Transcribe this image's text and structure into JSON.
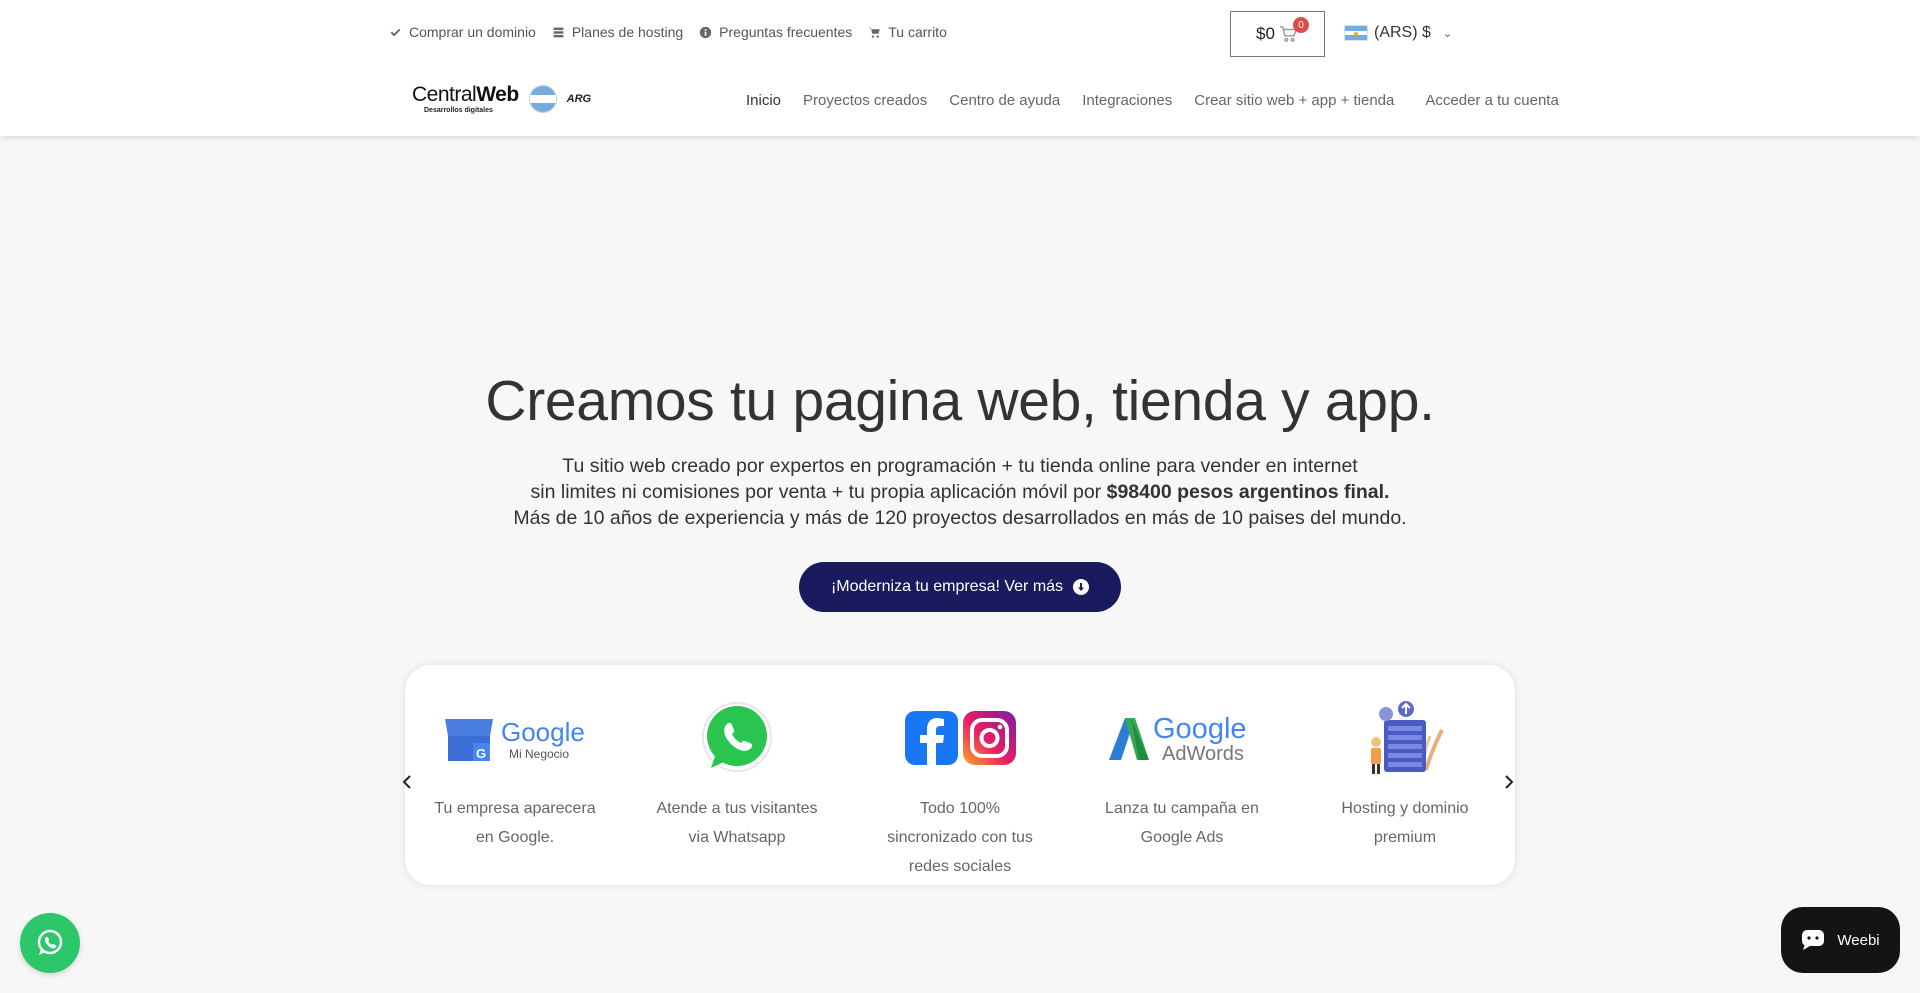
{
  "topbar": {
    "links": [
      {
        "label": "Comprar un dominio",
        "icon": "check-icon"
      },
      {
        "label": "Planes de hosting",
        "icon": "server-icon"
      },
      {
        "label": "Preguntas frecuentes",
        "icon": "info-icon"
      },
      {
        "label": "Tu carrito",
        "icon": "cart-icon"
      }
    ],
    "cart": {
      "total": "$0",
      "count": "0"
    },
    "currency": {
      "label": "(ARS) $",
      "flag": "argentina-flag"
    }
  },
  "logo": {
    "main": "Central",
    "bold": "Web",
    "sub": "Desarrollos digitales",
    "tag": "ARG"
  },
  "nav": {
    "items": [
      "Inicio",
      "Proyectos creados",
      "Centro de ayuda",
      "Integraciones",
      "Crear sitio web + app + tienda"
    ],
    "account": "Acceder a tu cuenta"
  },
  "hero": {
    "title": "Creamos tu pagina web, tienda y app.",
    "line1": "Tu sitio web creado por expertos en programación + tu tienda online para vender en internet",
    "line2_pre": "sin limites ni comisiones por venta + tu propia aplicación móvil por ",
    "line2_bold": "$98400 pesos argentinos final.",
    "line3": "Más de 10 años de experiencia y más de 120 proyectos desarrollados en más de 10 paises del mundo.",
    "cta": "¡Moderniza tu empresa! Ver más"
  },
  "features": [
    {
      "icon": "google-mi-negocio-icon",
      "line1": "Tu empresa aparecera",
      "line2": "en Google.",
      "line3": ""
    },
    {
      "icon": "whatsapp-icon",
      "line1": "Atende a tus visitantes",
      "line2": "via Whatsapp",
      "line3": ""
    },
    {
      "icon": "facebook-instagram-icon",
      "line1": "Todo 100%",
      "line2": "sincronizado con tus",
      "line3": "redes sociales"
    },
    {
      "icon": "google-adwords-icon",
      "line1": "Lanza tu campaña en",
      "line2": "Google Ads",
      "line3": ""
    },
    {
      "icon": "hosting-server-icon",
      "line1": "Hosting y dominio",
      "line2": "premium",
      "line3": ""
    }
  ],
  "logos": {
    "google": "Google",
    "mi_negocio": "Mi Negocio",
    "adwords": "AdWords"
  },
  "chat_widget": {
    "label": "Weebi"
  },
  "colors": {
    "cta": "#1a1a5e",
    "whatsapp": "#2cc76a",
    "badge": "#e14a4a",
    "chat": "#141414"
  }
}
